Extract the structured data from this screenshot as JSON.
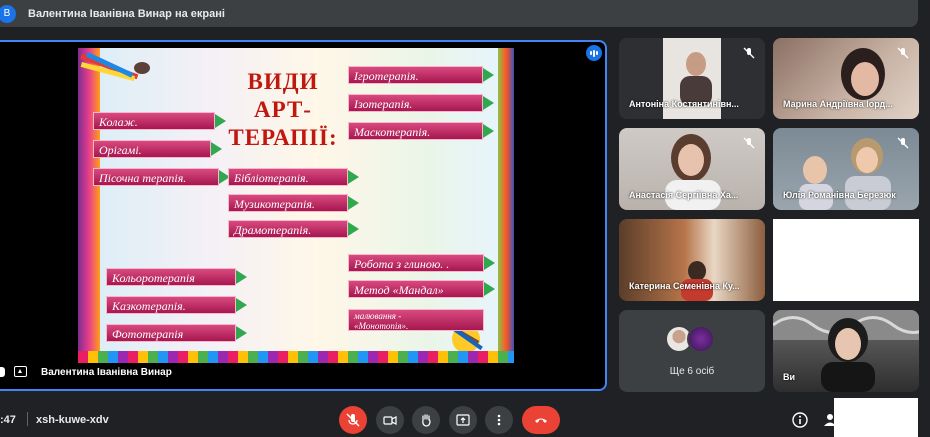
{
  "topbar": {
    "avatar_letter": "В",
    "text": "Валентина Іванівна Винар на екрані"
  },
  "stage": {
    "presenter_name": "Валентина Іванівна Винар",
    "slide": {
      "title_lines": [
        "ВИДИ",
        "АРТ-",
        "ТЕРАПІЇ:"
      ],
      "items": [
        "Колаж.",
        "Орігамі.",
        "Пісочна терапія.",
        "Ігротерапія.",
        "Ізотерапія.",
        "Маскотерапія.",
        "Бібліотерапія.",
        "Музикотерапія.",
        "Драмотерапія.",
        "Кольоротерапія",
        "Казкотерапія.",
        "Фототерапія",
        "Робота з глиною. .",
        "Метод «Мандал»"
      ],
      "small_item_lines": [
        "малювання -",
        "«Монотопія»."
      ]
    }
  },
  "participants": [
    {
      "name": "Антоніна Костянтинівн...",
      "muted": true
    },
    {
      "name": "Марина Андріївна Іорд...",
      "muted": true
    },
    {
      "name": "Анастасія Сергіївна Ха...",
      "muted": true
    },
    {
      "name": "Юлія Романівна Березюк",
      "muted": true
    },
    {
      "name": "Катерина Семенівна Ку...",
      "muted": false
    },
    {
      "name": "",
      "muted": false
    },
    {
      "name": "Ви",
      "muted": false
    }
  ],
  "more_participants_label": "Ще 6 осіб",
  "bottombar": {
    "time": ":47",
    "meeting_code": "xsh-kuwe-xdv"
  },
  "colors": {
    "accent": "#1a73e8",
    "danger": "#ea4335",
    "tile_bg": "#3c4043",
    "app_bg": "#202124"
  },
  "icons": [
    "mic-off-icon",
    "camera-icon",
    "raise-hand-icon",
    "present-icon",
    "more-vert-icon",
    "hang-up-icon",
    "info-icon",
    "people-icon"
  ]
}
